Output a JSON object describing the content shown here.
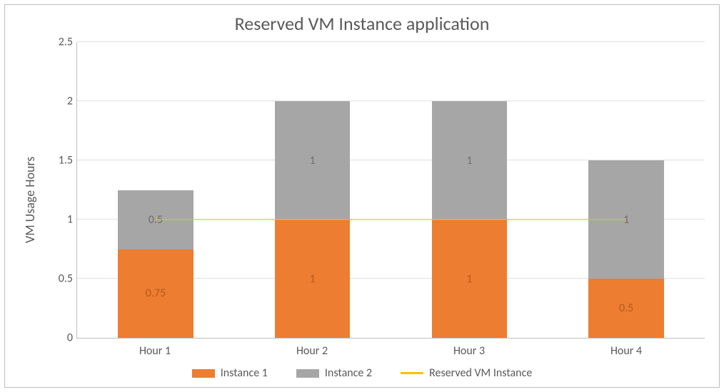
{
  "chart_data": {
    "type": "bar",
    "stacked": true,
    "title": "Reserved VM Instance application",
    "xlabel": "",
    "ylabel": "VM Usage Hours",
    "categories": [
      "Hour 1",
      "Hour 2",
      "Hour 3",
      "Hour 4"
    ],
    "series": [
      {
        "name": "Instance 1",
        "values": [
          0.75,
          1,
          1,
          0.5
        ],
        "color": "#ed7d31"
      },
      {
        "name": "Instance 2",
        "values": [
          0.5,
          1,
          1,
          1
        ],
        "color": "#a6a6a6"
      }
    ],
    "line_series": {
      "name": "Reserved VM Instance",
      "values": [
        1,
        1,
        1,
        1
      ],
      "color": "#ffc000"
    },
    "ylim": [
      0,
      2.5
    ],
    "yticks": [
      0,
      0.5,
      1,
      1.5,
      2,
      2.5
    ],
    "grid": true,
    "legend_position": "bottom"
  },
  "title": "Reserved VM Instance application",
  "ylabel": "VM Usage Hours",
  "yticks": {
    "t0": "0",
    "t1": "0.5",
    "t2": "1",
    "t3": "1.5",
    "t4": "2",
    "t5": "2.5"
  },
  "bars": {
    "c0": {
      "label": "Hour 1",
      "s1": "0.75",
      "s2": "0.5"
    },
    "c1": {
      "label": "Hour 2",
      "s1": "1",
      "s2": "1"
    },
    "c2": {
      "label": "Hour 3",
      "s1": "1",
      "s2": "1"
    },
    "c3": {
      "label": "Hour 4",
      "s1": "0.5",
      "s2": "1"
    }
  },
  "legend": {
    "l1": "Instance 1",
    "l2": "Instance 2",
    "l3": "Reserved VM Instance"
  }
}
